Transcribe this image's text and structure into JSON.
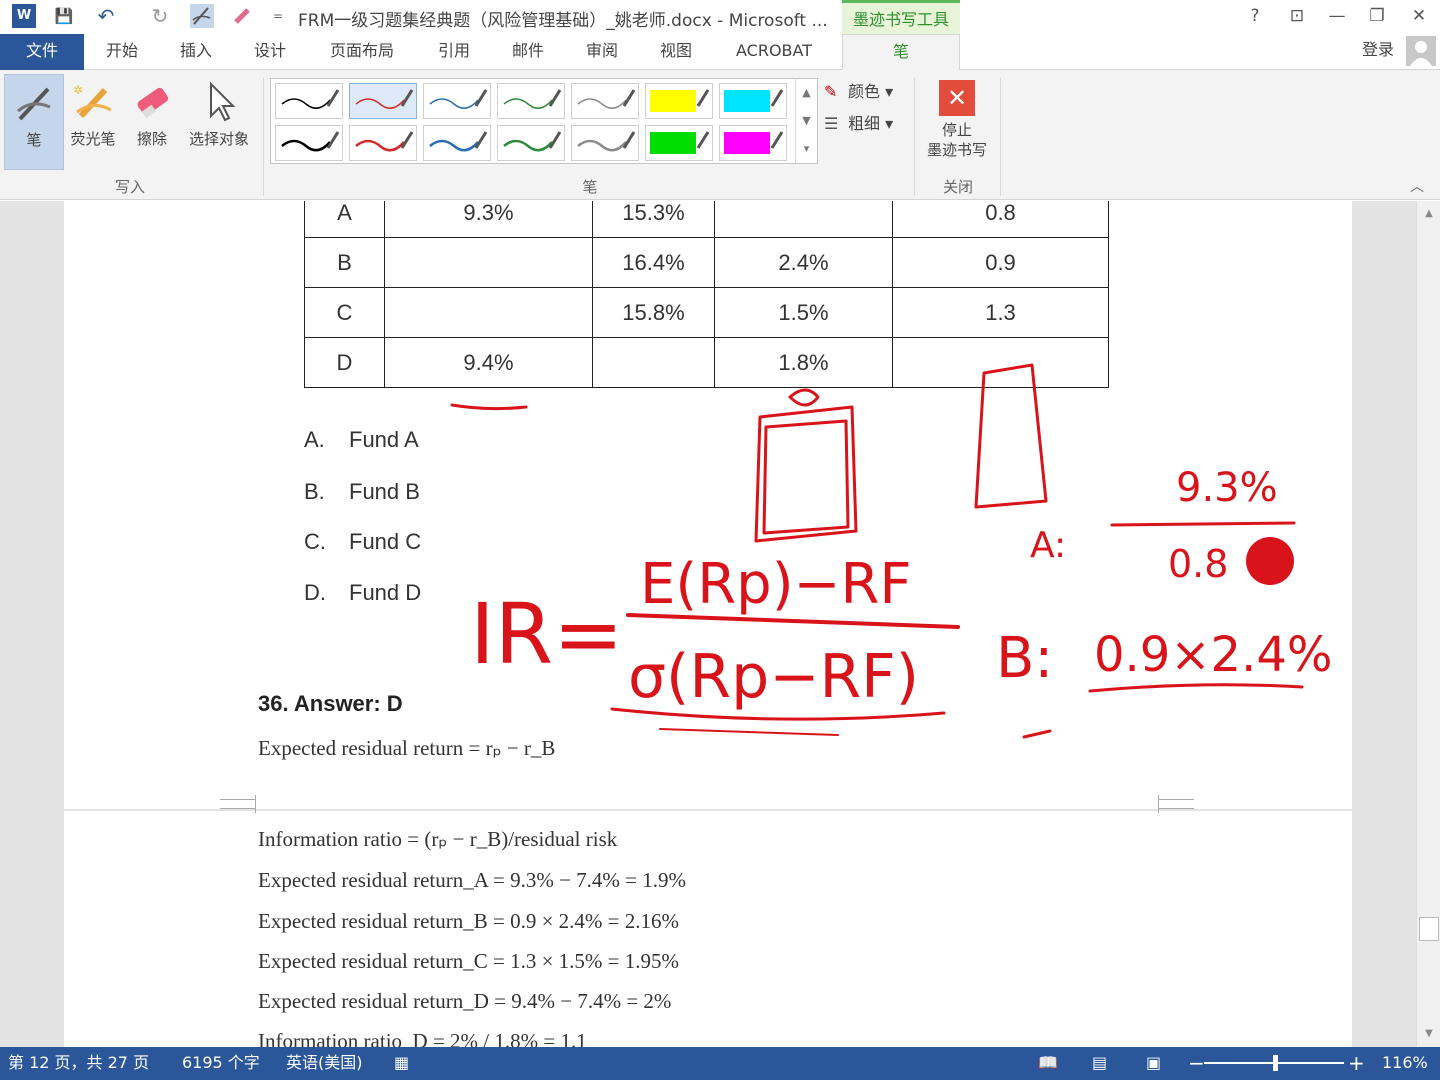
{
  "titlebar": {
    "title": "FRM一级习题集经典题（风险管理基础）_姚老师.docx - Microsoft ...",
    "context_tab_label": "墨迹书写工具",
    "help": "?",
    "restore_ribbon": "⊡",
    "minimize": "—",
    "maximize": "❐",
    "close": "✕"
  },
  "quick_access": {
    "word_logo": "W",
    "save": "💾",
    "undo": "↶",
    "redo": "↻",
    "customize": "="
  },
  "tabs": {
    "file": "文件",
    "items": [
      "开始",
      "插入",
      "设计",
      "页面布局",
      "引用",
      "邮件",
      "审阅",
      "视图",
      "ACROBAT"
    ],
    "active": "笔",
    "signin": "登录"
  },
  "ribbon": {
    "tools": {
      "pen": "笔",
      "highlighter": "荧光笔",
      "eraser": "擦除",
      "select_objects": "选择对象"
    },
    "group_write": "写入",
    "group_pens": "笔",
    "group_close": "关闭",
    "color": "颜色",
    "thickness": "粗细",
    "stop_inking_line1": "停止",
    "stop_inking_line2": "墨迹书写",
    "pen_swatches": [
      {
        "color": "#000000",
        "kind": "pen"
      },
      {
        "color": "#d42a2a",
        "kind": "pen"
      },
      {
        "color": "#2b6cb0",
        "kind": "pen"
      },
      {
        "color": "#2e8b3e",
        "kind": "pen"
      },
      {
        "color": "#8a8a8a",
        "kind": "pen"
      },
      {
        "color": "#ffff00",
        "kind": "highlighter"
      },
      {
        "color": "#00e5ff",
        "kind": "highlighter"
      },
      {
        "color": "#000000",
        "kind": "pen"
      },
      {
        "color": "#d42a2a",
        "kind": "pen"
      },
      {
        "color": "#2b6cb0",
        "kind": "pen"
      },
      {
        "color": "#2e8b3e",
        "kind": "pen"
      },
      {
        "color": "#8a8a8a",
        "kind": "pen"
      },
      {
        "color": "#00dd00",
        "kind": "highlighter"
      },
      {
        "color": "#ff00ff",
        "kind": "highlighter"
      }
    ]
  },
  "table": {
    "rows": [
      [
        "A",
        "9.3%",
        "15.3%",
        "",
        "0.8"
      ],
      [
        "B",
        "",
        "16.4%",
        "2.4%",
        "0.9"
      ],
      [
        "C",
        "",
        "15.8%",
        "1.5%",
        "1.3"
      ],
      [
        "D",
        "9.4%",
        "",
        "1.8%",
        ""
      ]
    ]
  },
  "options": [
    {
      "letter": "A.",
      "text": "Fund A"
    },
    {
      "letter": "B.",
      "text": "Fund B"
    },
    {
      "letter": "C.",
      "text": "Fund C"
    },
    {
      "letter": "D.",
      "text": "Fund D"
    }
  ],
  "answer": {
    "heading": "36.  Answer: D",
    "lines": [
      "Expected residual return = rₚ − r_B",
      "Information ratio = (rₚ − r_B)/residual risk",
      "Expected residual return_A = 9.3% − 7.4% = 1.9%",
      "Expected residual return_B = 0.9 × 2.4%  = 2.16%",
      "Expected residual return_C = 1.3 × 1.5% = 1.95%",
      "Expected residual return_D = 9.4% − 7.4% = 2%",
      "Information ratio_D = 2% / 1.8% = 1.1"
    ]
  },
  "ink": {
    "color": "#d8141a",
    "formula_lhs": "IR=",
    "formula_num": "E(Rp)−RF",
    "formula_den": "σ(Rp−RF)",
    "note_a_label": "A:",
    "note_a_num": "9.3%",
    "note_a_den": "0.8",
    "note_b_label": "B:",
    "note_b_expr": "0.9×2.4%"
  },
  "status": {
    "page": "第 12 页，共 27 页",
    "words": "6195 个字",
    "language": "英语(美国)",
    "zoom": "116%",
    "zoom_level_percent": 116
  }
}
